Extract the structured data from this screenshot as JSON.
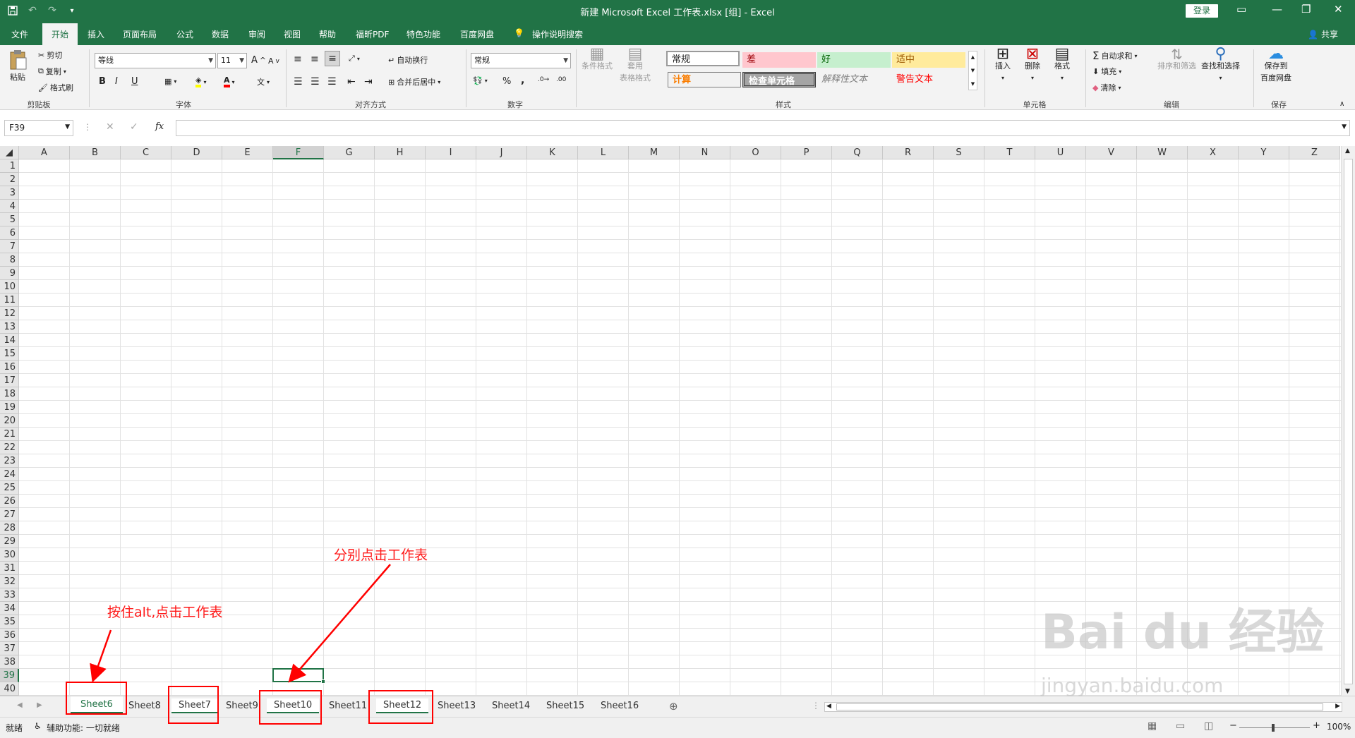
{
  "titlebar": {
    "title": "新建 Microsoft Excel 工作表.xlsx  [组]  -  Excel",
    "login": "登录"
  },
  "ribbon_tabs": [
    "文件",
    "开始",
    "插入",
    "页面布局",
    "公式",
    "数据",
    "审阅",
    "视图",
    "帮助",
    "福昕PDF",
    "特色功能",
    "百度网盘",
    "操作说明搜索"
  ],
  "share": "共享",
  "ribbon": {
    "clipboard": {
      "paste": "粘贴",
      "cut": "剪切",
      "copy": "复制",
      "format_painter": "格式刷",
      "label": "剪贴板"
    },
    "font": {
      "font_name": "等线",
      "font_size": "11",
      "bold": "B",
      "italic": "I",
      "underline": "U",
      "grow": "A",
      "shrink": "A",
      "label": "字体"
    },
    "alignment": {
      "wrap": "自动换行",
      "merge": "合并后居中",
      "label": "对齐方式"
    },
    "number": {
      "format": "常规",
      "percent": "%",
      "comma": ",",
      "label": "数字"
    },
    "styles": {
      "conditional": "条件格式",
      "table_format_1": "套用",
      "table_format_2": "表格格式",
      "cells": [
        "常规",
        "差",
        "好",
        "适中",
        "计算",
        "检查单元格",
        "解释性文本",
        "警告文本"
      ],
      "label": "样式"
    },
    "cells": {
      "insert": "插入",
      "delete": "删除",
      "format": "格式",
      "label": "单元格"
    },
    "editing": {
      "autosum": "自动求和",
      "fill": "填充",
      "clear": "清除",
      "sort": "排序和筛选",
      "find": "查找和选择",
      "label": "编辑"
    },
    "save": {
      "save_1": "保存到",
      "save_2": "百度网盘",
      "label": "保存"
    }
  },
  "formula_bar": {
    "name_box": "F39",
    "fx": "fx",
    "value": ""
  },
  "columns": [
    "A",
    "B",
    "C",
    "D",
    "E",
    "F",
    "G",
    "H",
    "I",
    "J",
    "K",
    "L",
    "M",
    "N",
    "O",
    "P",
    "Q",
    "R",
    "S",
    "T",
    "U",
    "V",
    "W",
    "X",
    "Y",
    "Z"
  ],
  "selected_column": "F",
  "rows": [
    "1",
    "2",
    "3",
    "4",
    "5",
    "6",
    "7",
    "8",
    "9",
    "10",
    "11",
    "12",
    "13",
    "14",
    "15",
    "16",
    "17",
    "18",
    "19",
    "20",
    "21",
    "22",
    "23",
    "24",
    "25",
    "26",
    "27",
    "28",
    "29",
    "30",
    "31",
    "32",
    "33",
    "34",
    "35",
    "36",
    "37",
    "38",
    "39",
    "40"
  ],
  "selected_row": "39",
  "sheets": [
    "Sheet6",
    "Sheet8",
    "Sheet7",
    "Sheet9",
    "Sheet10",
    "Sheet11",
    "Sheet12",
    "Sheet13",
    "Sheet14",
    "Sheet15",
    "Sheet16"
  ],
  "status": {
    "ready": "就绪",
    "accessibility": "辅助功能: 一切就绪",
    "zoom": "100%"
  },
  "annotations": {
    "hold_alt": "按住alt,点击工作表",
    "click_each": "分别点击工作表"
  },
  "watermark": {
    "brand": "Bai  du 经验",
    "url": "jingyan.baidu.com"
  },
  "colors": {
    "excel_green": "#217346",
    "annotation_red": "#ff0000"
  }
}
